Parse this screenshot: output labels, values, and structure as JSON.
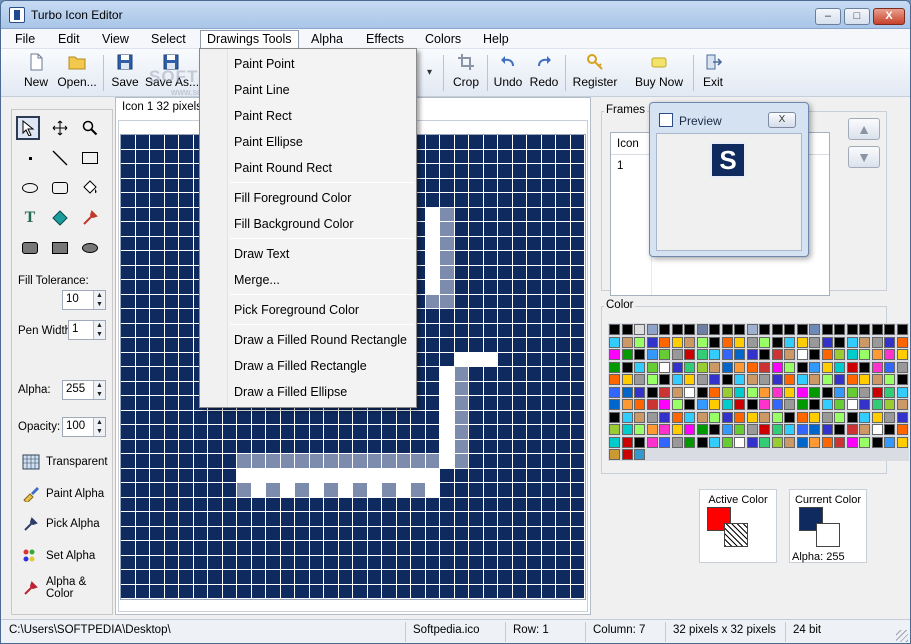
{
  "window": {
    "title": "Turbo Icon Editor",
    "minimize": "–",
    "maximize": "□",
    "close": "X"
  },
  "menubar": [
    "File",
    "Edit",
    "View",
    "Select",
    "Drawings Tools",
    "Alpha",
    "Effects",
    "Colors",
    "Help"
  ],
  "toolbar": {
    "new": "New",
    "open": "Open...",
    "save": "Save",
    "save_as": "Save As...",
    "crop": "Crop",
    "undo": "Undo",
    "redo": "Redo",
    "register": "Register",
    "buy_now": "Buy Now",
    "exit": "Exit"
  },
  "watermark": {
    "main": "SOFTPEDIA",
    "sub": "www.softpedia.com"
  },
  "dropdown": {
    "items": [
      "Paint Point",
      "Paint Line",
      "Paint Rect",
      "Paint Ellipse",
      "Paint Round Rect",
      "Fill Foreground Color",
      "Fill Background Color",
      "Draw Text",
      "Merge...",
      "Pick Foreground Color",
      "Draw a Filled Round Rectangle",
      "Draw a Filled Rectangle",
      "Draw a Filled Ellipse"
    ]
  },
  "left_panel": {
    "fill_tolerance_label": "Fill Tolerance:",
    "fill_tolerance_value": "10",
    "pen_width_label": "Pen Width:",
    "pen_width_value": "1",
    "alpha_label": "Alpha:",
    "alpha_value": "255",
    "opacity_label": "Opacity:",
    "opacity_value": "100",
    "actions": [
      "Transparent",
      "Paint Alpha",
      "Pick Alpha",
      "Set Alpha",
      "Alpha & Color"
    ]
  },
  "canvas": {
    "tab_label": "Icon 1 32 pixels"
  },
  "frames": {
    "title": "Frames",
    "column": "Icon",
    "rows": [
      "1"
    ]
  },
  "preview": {
    "title": "Preview",
    "close": "X",
    "letter": "S"
  },
  "color_section": {
    "title": "Color"
  },
  "active_color": {
    "label": "Active Color",
    "fg": "#ff0000"
  },
  "current_color": {
    "label": "Current Color",
    "alpha_text": "Alpha: 255",
    "fg": "#0f2a5e"
  },
  "status": {
    "path": "C:\\Users\\SOFTPEDIA\\Desktop\\",
    "file": "Softpedia.ico",
    "row": "Row: 1",
    "column": "Column: 7",
    "size": "32 pixels x 32 pixels",
    "depth": "24 bit"
  },
  "colors": {
    "navy": "#0f2a5e",
    "gray": "#7d8cac",
    "white": "#ffffff",
    "red": "#ff0000"
  }
}
